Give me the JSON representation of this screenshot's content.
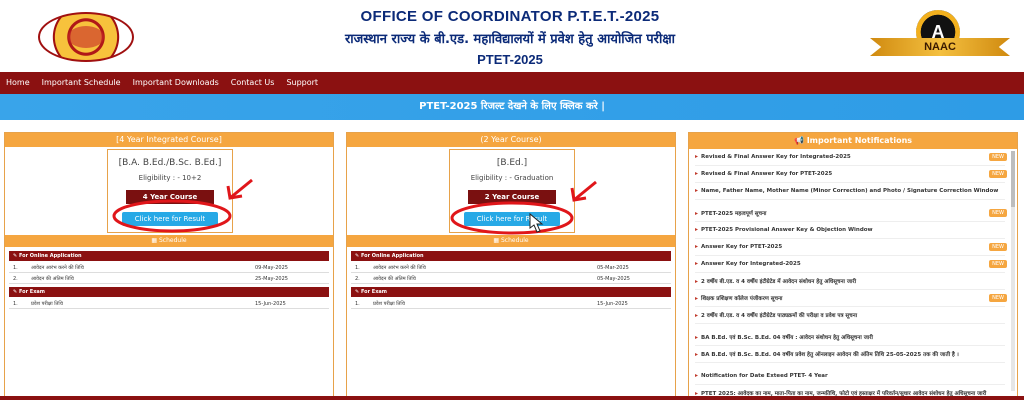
{
  "header": {
    "title_en": "OFFICE OF COORDINATOR P.T.E.T.-2025",
    "title_hi": "राजस्थान राज्य के बी.एड. महाविद्यालयों में प्रवेश हेतु आयोजित परीक्षा",
    "subtitle": "PTET-2025",
    "naac_grade": "A",
    "naac_label": "NAAC"
  },
  "nav": {
    "items": [
      "Home",
      "Important Schedule",
      "Important Downloads",
      "Contact Us",
      "Support"
    ]
  },
  "banner": {
    "text": "PTET-2025 रिजल्ट देखने के लिए क्लिक करे |"
  },
  "panels": [
    {
      "header": "[4 Year Integrated Course]",
      "course": "[B.A. B.Ed./B.Sc. B.Ed.]",
      "eligibility": "Eligibility : - 10+2",
      "course_button": "4 Year Course",
      "result_button": "Click here for Result",
      "schedule_label": "Schedule",
      "online_section": "For Online Application",
      "online_rows": [
        {
          "no": "1.",
          "label": "आवेदन आरंभ करने की तिथि",
          "date": "09-May-2025"
        },
        {
          "no": "2.",
          "label": "आवेदन की अंतिम तिथि",
          "date": "25-May-2025"
        }
      ],
      "exam_section": "For Exam",
      "exam_rows": [
        {
          "no": "1.",
          "label": "प्रवेश परीक्षा तिथि",
          "date": "15-Jun-2025"
        }
      ]
    },
    {
      "header": "(2 Year Course)",
      "course": "[B.Ed.]",
      "eligibility": "Eligibility : - Graduation",
      "course_button": "2 Year Course",
      "result_button": "Click here for Result",
      "schedule_label": "Schedule",
      "online_section": "For Online Application",
      "online_rows": [
        {
          "no": "1.",
          "label": "आवेदन आरंभ करने की तिथि",
          "date": "05-Mar-2025"
        },
        {
          "no": "2.",
          "label": "आवेदन की अंतिम तिथि",
          "date": "05-May-2025"
        }
      ],
      "exam_section": "For Exam",
      "exam_rows": [
        {
          "no": "1.",
          "label": "प्रवेश परीक्षा तिथि",
          "date": "15-Jun-2025"
        }
      ]
    }
  ],
  "notifications": {
    "header": "Important Notifications",
    "new_label": "NEW",
    "items": [
      {
        "text": "Revised & Final Answer Key for Integrated-2025",
        "new": true
      },
      {
        "text": "Revised & Final Answer Key for PTET-2025",
        "new": true
      },
      {
        "text": "Name, Father Name, Mother Name (Minor Correction) and Photo / Signature Correction Window",
        "new": false
      },
      {
        "text": "PTET-2025 महत्वपूर्ण सूचना",
        "new": true
      },
      {
        "text": "PTET-2025 Provisional Answer Key & Objection Window",
        "new": false
      },
      {
        "text": "Answer Key for PTET-2025",
        "new": true
      },
      {
        "text": "Answer Key for Integrated-2025",
        "new": true
      },
      {
        "text": "2 वर्षीय बी.एड. व 4 वर्षीय इंटीग्रेटेड में आवेदन संशोधन हेतु अधिसूचना जारी",
        "new": false
      },
      {
        "text": "शिक्षक प्रशिक्षण कॉलेज पंजीकरण सूचना",
        "new": true
      },
      {
        "text": "2 वर्षीय बी.एड. व 4 वर्षीय इंटीग्रेटेड पाठ्यक्रमों की परीक्षा व प्रवेश पत्र सूचना",
        "new": false
      },
      {
        "text": "BA B.Ed. एवं B.Sc. B.Ed. 04 वर्षीय : आवेदन संशोधन हेतु अधिसूचना जारी",
        "new": false
      },
      {
        "text": "BA B.Ed. एवं B.Sc. B.Ed. 04 वर्षीय प्रवेश हेतु ऑनलाइन आवेदन की अंतिम तिथि 25-05-2025 तक की जाती है ।",
        "new": false
      },
      {
        "text": "Notification for Date Exteed PTET- 4 Year",
        "new": false
      },
      {
        "text": "PTET 2025: आवेदक का नाम, माता-पिता का नाम, जन्मतिथि, फोटो एवं हस्ताक्षर में परिवर्तन/सुधार आवेदन संशोधन हेतु अधिसूचना जारी",
        "new": false
      }
    ]
  },
  "colors": {
    "nav": "#8b1111",
    "banner": "#39a4ea",
    "accent": "#f5a640",
    "title": "#0b2a78",
    "result_button": "#27a9e6",
    "annotation": "#e0161a"
  }
}
